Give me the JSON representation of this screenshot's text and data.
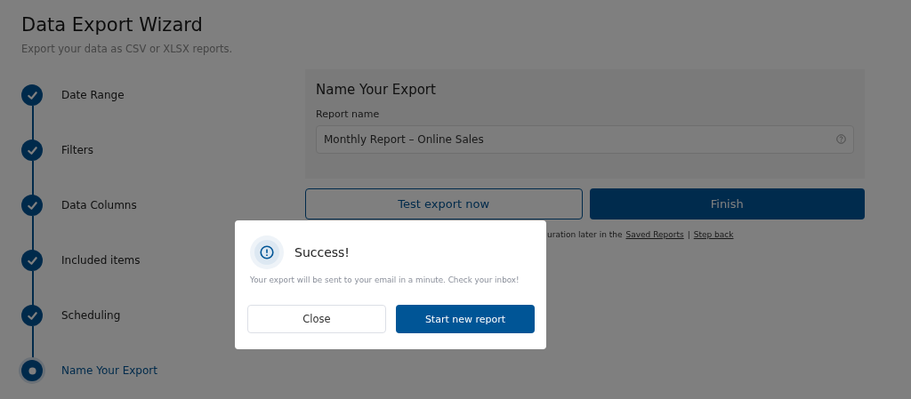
{
  "header": {
    "title": "Data Export Wizard",
    "subtitle": "Export your data as CSV or XLSX reports."
  },
  "steps": [
    {
      "label": "Date Range",
      "completed": true
    },
    {
      "label": "Filters",
      "completed": true
    },
    {
      "label": "Data Columns",
      "completed": true
    },
    {
      "label": "Included items",
      "completed": true
    },
    {
      "label": "Scheduling",
      "completed": true
    },
    {
      "label": "Name Your Export",
      "completed": false
    }
  ],
  "form": {
    "heading": "Name Your Export",
    "field_label": "Report name",
    "value": "Monthly Report – Online Sales"
  },
  "actions": {
    "secondary": "Test export now",
    "primary": "Finish"
  },
  "note": {
    "text": "uration later in the",
    "link": "Saved Reports",
    "separator": "|",
    "back_link": "Step back"
  },
  "dialog": {
    "title": "Success!",
    "message": "Your export will be sent to your email in a minute. Check your inbox!",
    "cancel": "Close",
    "confirm": "Start new report"
  }
}
